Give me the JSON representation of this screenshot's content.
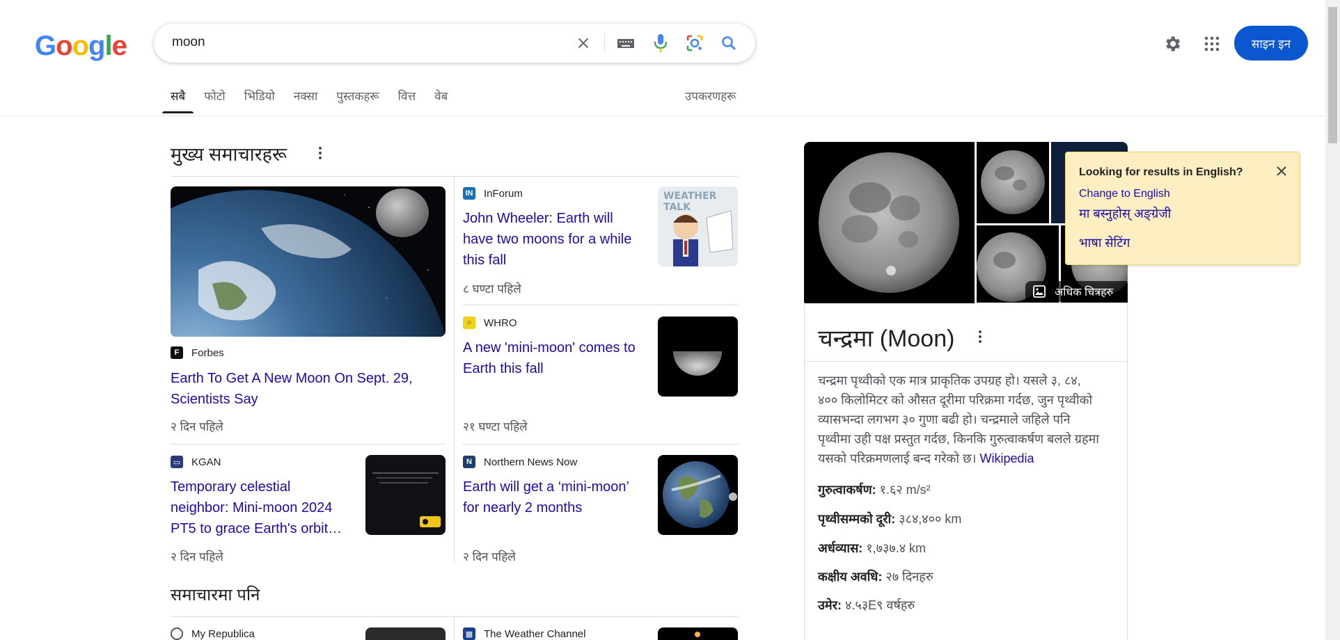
{
  "logo": {
    "letters": [
      "G",
      "o",
      "o",
      "g",
      "l",
      "e"
    ],
    "colors": [
      "#4285F4",
      "#EA4335",
      "#FBBC05",
      "#4285F4",
      "#34A853",
      "#EA4335"
    ]
  },
  "search": {
    "query": "moon"
  },
  "header": {
    "signin_label": "साइन इन"
  },
  "tabs": [
    "सबै",
    "फोटो",
    "भिडियो",
    "नक्सा",
    "पुस्तकहरू",
    "वित्त",
    "वेब"
  ],
  "tools_label": "उपकरणहरू",
  "top_stories": {
    "title": "मुख्य समाचारहरू",
    "main": {
      "source": "Forbes",
      "headline_1": "Earth To Get A New Moon On Sept. 29,",
      "headline_2": "Scientists Say",
      "time": "२ दिन पहिले"
    },
    "s1": {
      "source": "InForum",
      "headline_1": "John Wheeler: Earth will",
      "headline_2": "have two moons for a while",
      "headline_3": "this fall",
      "time": "८ घण्टा पहिले",
      "img_text": "WEATHER TALK"
    },
    "s2": {
      "source": "WHRO",
      "headline_1": "A new 'mini-moon' comes to",
      "headline_2": "Earth this fall",
      "time": "२१ घण्टा पहिले"
    },
    "s3": {
      "source": "KGAN",
      "headline_1": "Temporary celestial",
      "headline_2": "neighbor: Mini-moon 2024",
      "headline_3": "PT5 to grace Earth's orbit…",
      "time": "२ दिन पहिले"
    },
    "s4": {
      "source": "Northern News Now",
      "headline_1": "Earth will get a ‘mini-moon’",
      "headline_2": "for nearly 2 months",
      "time": "२ दिन पहिले"
    }
  },
  "also_in_news": {
    "title": "समाचारमा पनि",
    "s1": {
      "source": "My Republica"
    },
    "s2": {
      "source": "The Weather Channel"
    }
  },
  "knowledge_panel": {
    "title": "चन्द्रमा (Moon)",
    "more_images": "अधिक चित्रहरु",
    "desc_1": "चन्द्रमा पृथ्वीको एक मात्र प्राकृतिक उपग्रह हो। यसले ३, ८४,",
    "desc_2": "४०० किलोमिटर को औसत दूरीमा परिक्रमा गर्दछ, जुन पृथ्वीको",
    "desc_3": "व्यासभन्दा लगभग ३० गुणा बढी हो। चन्द्रमाले जहिले पनि",
    "desc_4": "पृथ्वीमा उही पक्ष प्रस्तुत गर्दछ, किनकि गुरुत्वाकर्षण बलले ग्रहमा",
    "desc_5": "यसको परिक्रमणलाई बन्द गरेको छ।",
    "desc_link": "Wikipedia",
    "facts": [
      {
        "label": "गुरुत्वाकर्षण:",
        "value": " १.६२ m/s²"
      },
      {
        "label": "पृथ्वीसम्मको दूरी:",
        "value": " ३८४,४०० km"
      },
      {
        "label": "अर्धव्यास:",
        "value": " १,७३७.४ km"
      },
      {
        "label": "कक्षीय अवधि:",
        "value": " २७ दिनहरु"
      },
      {
        "label": "उमेर:",
        "value": " ४.५३E९ वर्षहरु"
      }
    ]
  },
  "lang_popup": {
    "title": "Looking for results in English?",
    "link_1": "Change to English",
    "link_2": "मा बस्नुहोस् अङ्ग्रेजी",
    "link_3": "भाषा सेटिंग"
  }
}
